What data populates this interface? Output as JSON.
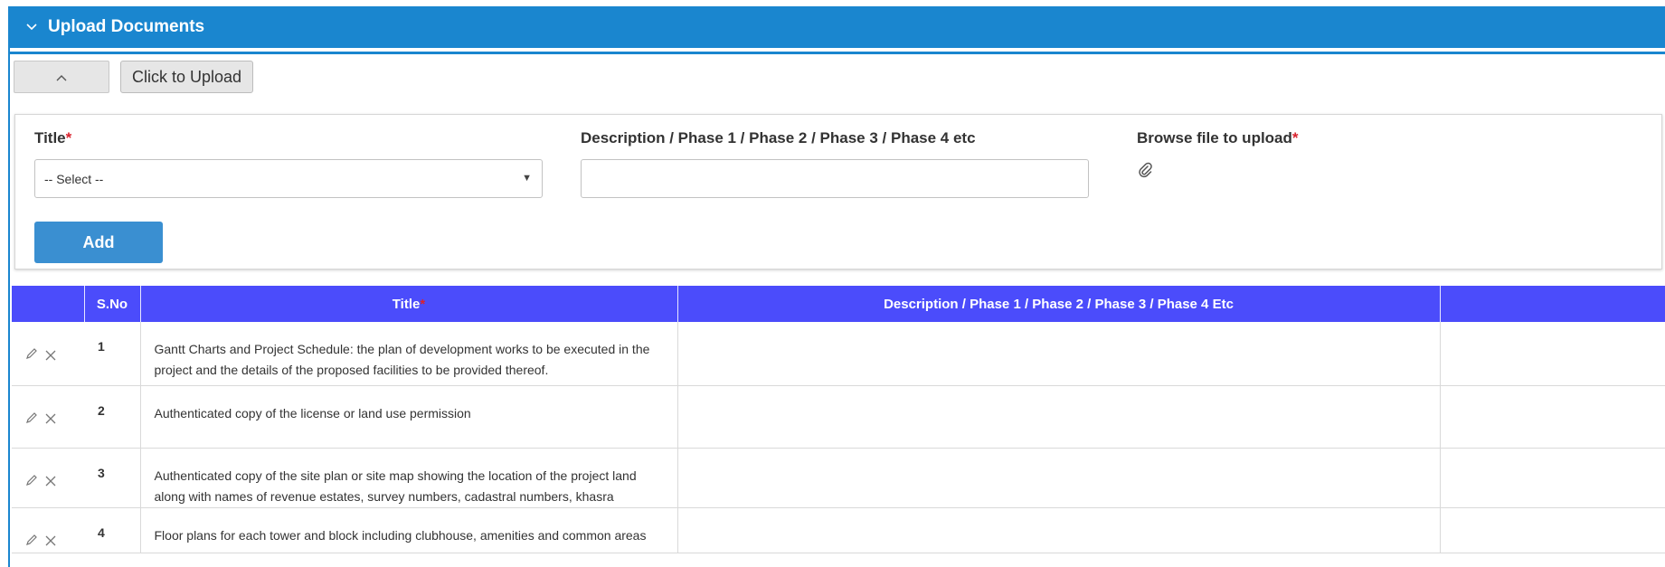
{
  "panel": {
    "title": "Upload Documents",
    "collapse_icon": "chevron-down-icon"
  },
  "toolbar": {
    "collapse_icon": "chevron-up-icon",
    "upload_label": "Click to Upload"
  },
  "form": {
    "title_label": "Title",
    "title_required_mark": "*",
    "title_select_value": "-- Select --",
    "description_label": "Description / Phase 1 / Phase 2 / Phase 3 / Phase 4 etc",
    "description_value": "",
    "browse_label": "Browse file to upload",
    "browse_required_mark": "*",
    "browse_icon": "paperclip-icon",
    "add_label": "Add"
  },
  "table": {
    "headers": {
      "actions": "",
      "sno": "S.No",
      "title": "Title",
      "title_required_mark": "*",
      "description": "Description / Phase 1 / Phase 2 / Phase 3 / Phase 4 Etc",
      "extra": ""
    },
    "rows": [
      {
        "sno": "1",
        "title": "Gantt Charts and Project Schedule: the plan of development works to be executed in the project and the details of the proposed facilities to be provided thereof.",
        "description": ""
      },
      {
        "sno": "2",
        "title": "Authenticated copy of the license or land use permission",
        "description": ""
      },
      {
        "sno": "3",
        "title": "Authenticated copy of the site plan or site map showing the location of the project land along with names of revenue estates, survey numbers, cadastral numbers, khasra",
        "description": ""
      },
      {
        "sno": "4",
        "title": "Floor plans for each tower and block including clubhouse, amenities and common areas",
        "description": ""
      }
    ]
  },
  "colors": {
    "panel_header": "#1a86cf",
    "table_header": "#4b4cfb",
    "add_button": "#3a8fd1",
    "required": "#d9232e"
  }
}
